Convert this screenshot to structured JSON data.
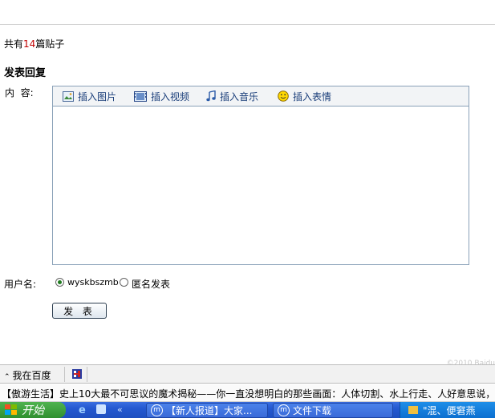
{
  "thread": {
    "count_prefix": "共有",
    "count_value": "14",
    "count_suffix": "篇贴子"
  },
  "reply": {
    "section_title": "发表回复",
    "content_label": "内  容:",
    "toolbar": [
      {
        "label": "插入图片",
        "icon": "image-icon"
      },
      {
        "label": "插入视频",
        "icon": "video-icon"
      },
      {
        "label": "插入音乐",
        "icon": "music-icon"
      },
      {
        "label": "插入表情",
        "icon": "smiley-icon"
      }
    ],
    "content_value": "",
    "user_label": "用户名:",
    "options": [
      {
        "label": "wyskbszmb",
        "selected": true
      },
      {
        "label": "匿名发表",
        "selected": false
      }
    ],
    "submit_label": "发 表"
  },
  "footer_faint": "©2010 Baidu",
  "statusbar": {
    "item_label": "我在百度",
    "item_icon": "chevron-up-icon",
    "extra_icon": "flag-icon"
  },
  "ticker": {
    "text": "【傲游生活】史上10大最不可思议的魔术揭秘——你一直没想明白的那些画面：人体切割、水上行走、人好意思说，"
  },
  "taskbar": {
    "start_label": "开始",
    "tasks": [
      {
        "label": "【新人报道】大家..."
      },
      {
        "label": "文件下载"
      }
    ],
    "tray_label": "\"混、便窘燕"
  },
  "colors": {
    "accent_red": "#c00000",
    "toolbar_text": "#1a3e7a",
    "editor_border": "#8aa1b8",
    "taskbar_blue": "#2458d0",
    "start_green": "#3a9f3a"
  }
}
